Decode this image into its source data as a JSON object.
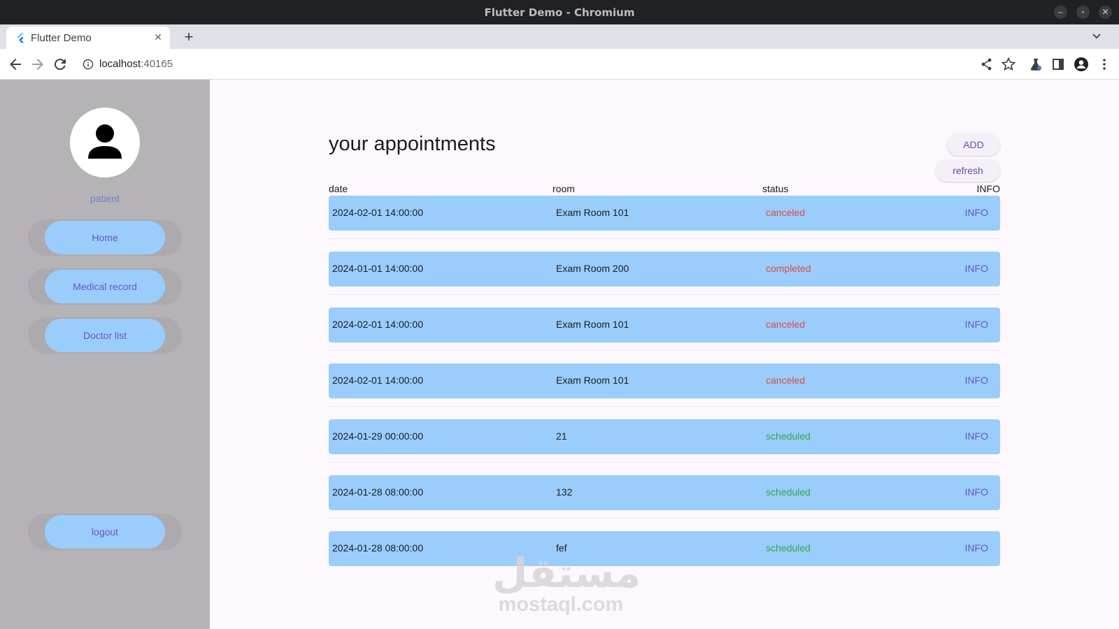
{
  "window": {
    "title": "Flutter Demo - Chromium"
  },
  "browser": {
    "tab_title": "Flutter Demo",
    "url_host": "localhost",
    "url_port": ":40165"
  },
  "sidebar": {
    "role": "patient",
    "nav": [
      {
        "label": "Home"
      },
      {
        "label": "Medical record"
      },
      {
        "label": "Doctor list"
      }
    ],
    "logout_label": "logout"
  },
  "main": {
    "heading": "your appointments",
    "add_label": "ADD",
    "refresh_label": "refresh",
    "columns": {
      "date": "date",
      "room": "room",
      "status": "status",
      "info": "INFO"
    },
    "rows": [
      {
        "date": "2024-02-01 14:00:00",
        "room": "Exam Room 101",
        "status": "canceled",
        "info": "INFO"
      },
      {
        "date": "2024-01-01 14:00:00",
        "room": "Exam Room 200",
        "status": "completed",
        "info": "INFO"
      },
      {
        "date": "2024-02-01 14:00:00",
        "room": "Exam Room 101",
        "status": "canceled",
        "info": "INFO"
      },
      {
        "date": "2024-02-01 14:00:00",
        "room": "Exam Room 101",
        "status": "canceled",
        "info": "INFO"
      },
      {
        "date": "2024-01-29 00:00:00",
        "room": "21",
        "status": "scheduled",
        "info": "INFO"
      },
      {
        "date": "2024-01-28 08:00:00",
        "room": "132",
        "status": "scheduled",
        "info": "INFO"
      },
      {
        "date": "2024-01-28 08:00:00",
        "room": "fef",
        "status": "scheduled",
        "info": "INFO"
      }
    ]
  },
  "watermark": {
    "arabic": "مستقل",
    "latin": "mostaql.com"
  },
  "colors": {
    "sidebar_bg": "#b5b3b6",
    "button_bg": "#9acdfb",
    "button_text": "#6a54c4",
    "status_canceled": "#e24b3b",
    "status_completed": "#e24b3b",
    "status_scheduled": "#36a84a"
  }
}
